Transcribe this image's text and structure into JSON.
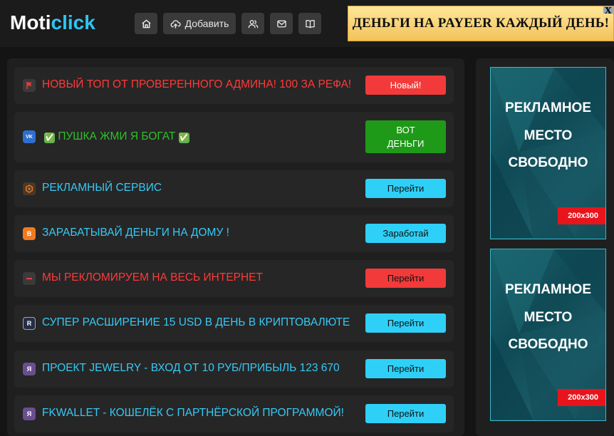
{
  "header": {
    "logo_part1": "Moti",
    "logo_part2": "click",
    "nav": {
      "add_label": "Добавить"
    },
    "banner_text": "ДЕНЬГИ НА PAYEER КАЖДЫЙ ДЕНЬ!",
    "banner_close": "x"
  },
  "listings": [
    {
      "title": "НОВЫЙ ТОП ОТ ПРОВЕРЕННОГО АДМИНА! 100 ЗА РЕФА!",
      "title_color": "#ff3a3a",
      "icon": "flag-icon",
      "icon_color": "#e23b3b",
      "button": "Новый!",
      "button_bg": "#f23a3a",
      "button_fg": "#ffffff"
    },
    {
      "title_prefix": "✅",
      "title": "ПУШКА ЖМИ Я БОГАТ",
      "title_suffix": "✅",
      "title_color": "#2ec02a",
      "icon": "vk-icon",
      "icon_color": "#2f6fcf",
      "icon_text": "VK",
      "button": "ВОТ ДЕНЬГИ",
      "button_bg": "#1f9a18",
      "button_fg": "#ffffff"
    },
    {
      "title": "РЕКЛАМНЫЙ СЕРВИС",
      "title_color": "#36c9f5",
      "icon": "hexagon-icon",
      "icon_color": "#e07b2a",
      "button": "Перейти",
      "button_bg": "#2fd0f7",
      "button_fg": "#111111"
    },
    {
      "title": "ЗАРАБАТЫВАЙ ДЕНЬГИ НА ДОМУ !",
      "title_color": "#36c9f5",
      "icon": "blogger-icon",
      "icon_color": "#f07a20",
      "icon_text": "B",
      "button": "Заработай",
      "button_bg": "#2fd0f7",
      "button_fg": "#111111"
    },
    {
      "title": "МЫ РЕКЛОМИРУЕМ НА ВЕСЬ ИНТЕРНЕТ",
      "title_color": "#ff3a3a",
      "icon": "dash-icon",
      "icon_color": "#e23b3b",
      "button": "Перейти",
      "button_bg": "#f23a3a",
      "button_fg": "#111111"
    },
    {
      "title": "СУПЕР РАСШИРЕНИЕ 15 USD В ДЕНЬ В КРИПТОВАЛЮТЕ",
      "title_color": "#36c9f5",
      "icon": "r-icon",
      "icon_color": "#262d46",
      "icon_text": "R",
      "button": "Перейти",
      "button_bg": "#2fd0f7",
      "button_fg": "#111111"
    },
    {
      "title": "ПРОЕКТ JEWELRY - ВХОД ОТ 10 РУБ/ПРИБЫЛЬ 123 670",
      "title_color": "#36c9f5",
      "icon": "ya-icon",
      "icon_color": "#6a4f8f",
      "icon_text": "Я",
      "button": "Перейти",
      "button_bg": "#2fd0f7",
      "button_fg": "#111111"
    },
    {
      "title": "FKWALLET - КОШЕЛЁК С ПАРТНЁРСКОЙ ПРОГРАММОЙ!",
      "title_color": "#36c9f5",
      "icon": "ya-icon",
      "icon_color": "#6a4f8f",
      "icon_text": "Я",
      "button": "Перейти",
      "button_bg": "#2fd0f7",
      "button_fg": "#111111"
    }
  ],
  "ads": [
    {
      "line1": "РЕКЛАМНОЕ",
      "line2": "МЕСТО",
      "line3": "СВОБОДНО",
      "size": "200x300"
    },
    {
      "line1": "РЕКЛАМНОЕ",
      "line2": "МЕСТО",
      "line3": "СВОБОДНО",
      "size": "200x300"
    }
  ]
}
